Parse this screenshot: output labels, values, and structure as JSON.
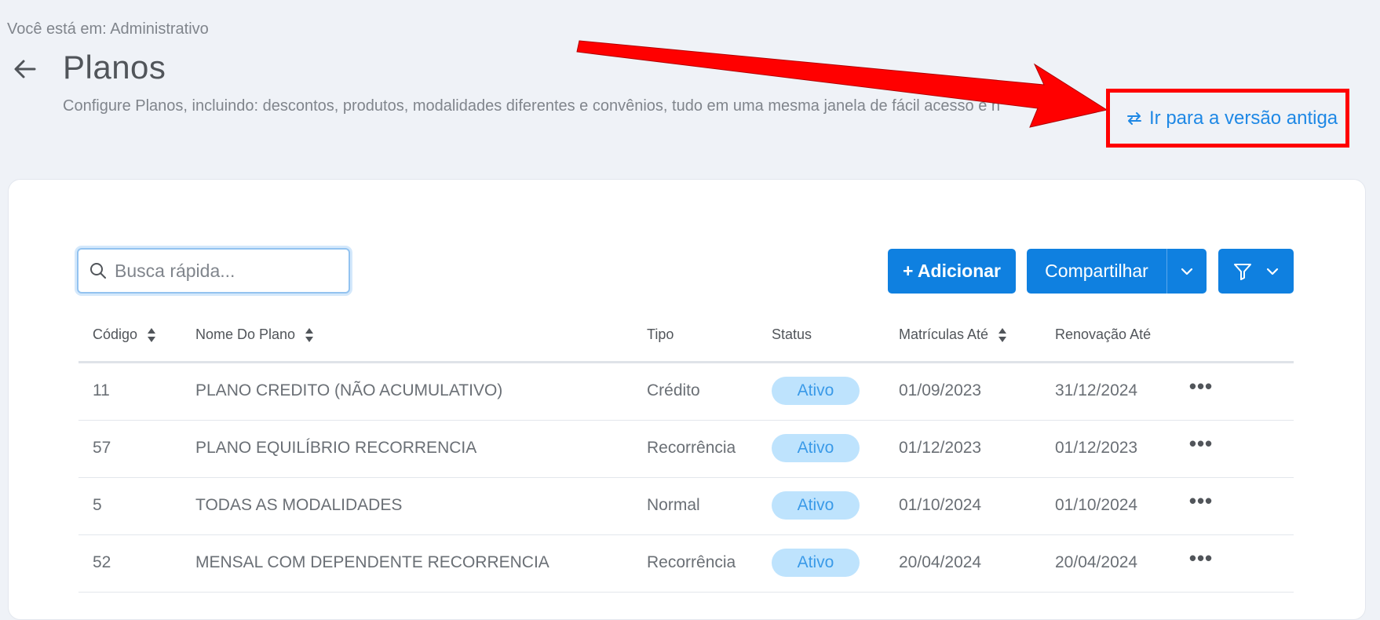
{
  "breadcrumb": "Você está em: Administrativo",
  "page": {
    "title": "Planos",
    "description": "Configure Planos, incluindo: descontos, produtos, modalidades diferentes e convênios, tudo em uma mesma janela de fácil acesso e n"
  },
  "old_version_link": "Ir para a versão antiga",
  "search": {
    "placeholder": "Busca rápida..."
  },
  "toolbar": {
    "add_label": "+ Adicionar",
    "share_label": "Compartilhar"
  },
  "table": {
    "headers": {
      "codigo": "Código",
      "nome": "Nome Do Plano",
      "tipo": "Tipo",
      "status": "Status",
      "matriculas": "Matrículas Até",
      "renovacao": "Renovação Até"
    },
    "rows": [
      {
        "codigo": "11",
        "nome": "PLANO CREDITO (NÃO ACUMULATIVO)",
        "tipo": "Crédito",
        "status": "Ativo",
        "matriculas": "01/09/2023",
        "renovacao": "31/12/2024"
      },
      {
        "codigo": "57",
        "nome": "PLANO EQUILÍBRIO RECORRENCIA",
        "tipo": "Recorrência",
        "status": "Ativo",
        "matriculas": "01/12/2023",
        "renovacao": "01/12/2023"
      },
      {
        "codigo": "5",
        "nome": "TODAS AS MODALIDADES",
        "tipo": "Normal",
        "status": "Ativo",
        "matriculas": "01/10/2024",
        "renovacao": "01/10/2024"
      },
      {
        "codigo": "52",
        "nome": "MENSAL COM DEPENDENTE RECORRENCIA",
        "tipo": "Recorrência",
        "status": "Ativo",
        "matriculas": "20/04/2024",
        "renovacao": "20/04/2024"
      }
    ]
  },
  "colors": {
    "primary": "#0f80e0",
    "link": "#1e88e5",
    "highlight": "#ff0000",
    "badge_bg": "#bee3fd",
    "badge_text": "#3a9ae8",
    "page_bg": "#eff2f7"
  },
  "icons": {
    "back": "arrow-left-icon",
    "switch": "switch-arrows-icon",
    "search": "search-icon",
    "share_dropdown": "chevron-down-icon",
    "filter": "filter-icon",
    "sort": "sort-icon",
    "more": "more-horizontal-icon"
  }
}
